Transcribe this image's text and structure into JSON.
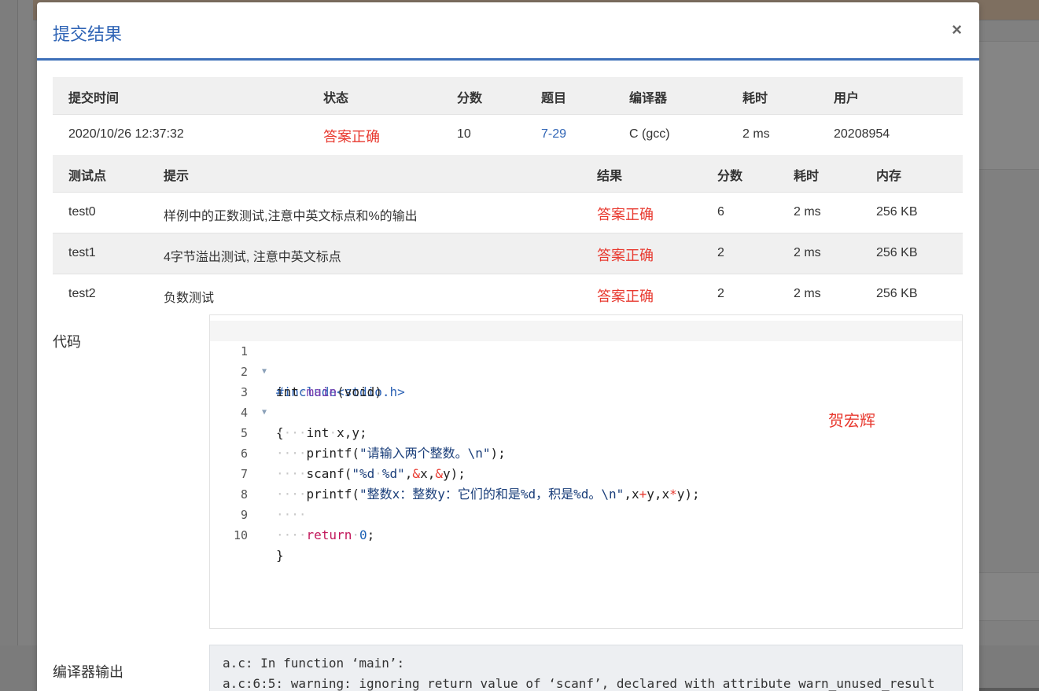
{
  "modal": {
    "title": "提交结果",
    "close_label": "×"
  },
  "summary": {
    "headers": [
      "提交时间",
      "状态",
      "分数",
      "题目",
      "编译器",
      "耗时",
      "用户"
    ],
    "row": {
      "time": "2020/10/26 12:37:32",
      "status": "答案正确",
      "score": "10",
      "problem": "7-29",
      "compiler": "C (gcc)",
      "elapsed": "2 ms",
      "user": "20208954"
    }
  },
  "tests": {
    "headers": [
      "测试点",
      "提示",
      "结果",
      "分数",
      "耗时",
      "内存"
    ],
    "rows": [
      {
        "id": "test0",
        "hint": "样例中的正数测试,注意中英文标点和%的输出",
        "result": "答案正确",
        "score": "6",
        "time": "2 ms",
        "mem": "256 KB"
      },
      {
        "id": "test1",
        "hint": "4字节溢出测试, 注意中英文标点",
        "result": "答案正确",
        "score": "2",
        "time": "2 ms",
        "mem": "256 KB"
      },
      {
        "id": "test2",
        "hint": "负数测试",
        "result": "答案正确",
        "score": "2",
        "time": "2 ms",
        "mem": "256 KB"
      }
    ]
  },
  "code": {
    "label": "代码",
    "line_numbers": [
      "1",
      "2",
      "3",
      "4",
      "5",
      "6",
      "7",
      "8",
      "9",
      "10"
    ],
    "watermark": "贺宏辉"
  },
  "compiler_output": {
    "label": "编译器输出",
    "lines": [
      "a.c: In function ‘main’:",
      "a.c:6:5: warning: ignoring return value of ‘scanf’, declared with attribute warn_unused_result"
    ]
  },
  "colors": {
    "accent": "#2f64b5",
    "correct": "#e8392f"
  }
}
